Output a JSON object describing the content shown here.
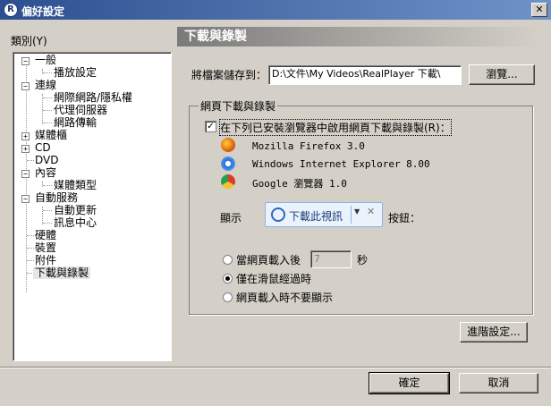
{
  "window": {
    "title": "偏好設定",
    "close_glyph": "✕",
    "app_icon_glyph": "R"
  },
  "category_label": "類別(Y)",
  "tree": {
    "items": [
      {
        "label": "一般",
        "toggle": "−"
      },
      {
        "label": "播放設定"
      },
      {
        "label": "連線",
        "toggle": "−"
      },
      {
        "label": "網際網路/隱私權"
      },
      {
        "label": "代理伺服器"
      },
      {
        "label": "網路傳輸"
      },
      {
        "label": "媒體櫃",
        "toggle": "+"
      },
      {
        "label": "CD",
        "toggle": "+"
      },
      {
        "label": "DVD"
      },
      {
        "label": "內容",
        "toggle": "−"
      },
      {
        "label": "媒體類型"
      },
      {
        "label": "自動服務",
        "toggle": "−"
      },
      {
        "label": "自動更新"
      },
      {
        "label": "訊息中心"
      },
      {
        "label": "硬體"
      },
      {
        "label": "裝置"
      },
      {
        "label": "附件"
      },
      {
        "label": "下載與錄製",
        "selected": true
      }
    ]
  },
  "panel": {
    "title": "下載與錄製",
    "save_label": "將檔案儲存到：",
    "save_path": "D:\\文件\\My Videos\\RealPlayer 下載\\",
    "browse_label": "瀏覽...",
    "group_title": "網頁下載與錄製",
    "enable_checkbox_label": "在下列已安裝瀏覽器中啟用網頁下載與錄製(R)：",
    "enable_checked": true,
    "check_glyph": "✓",
    "browsers": [
      {
        "name": "Mozilla Firefox 3.0",
        "icon": "firefox-icon",
        "color": "#e66000"
      },
      {
        "name": "Windows Internet Explorer 8.00",
        "icon": "ie-icon",
        "color": "#1e6fd9"
      },
      {
        "name": "Google 瀏覽器 1.0",
        "icon": "chrome-icon",
        "color": "#dd3b2a"
      }
    ],
    "show_label": "顯示",
    "button_suffix": "按鈕：",
    "download_button_text": "下載此視訊",
    "download_arrow_glyph": "▼",
    "download_close_glyph": "✕",
    "option_after_load_label": "當網頁載入後",
    "option_after_load_value": "7",
    "seconds_unit": "秒",
    "option_hover_label": "僅在滑鼠經過時",
    "option_never_label": "網頁載入時不要顯示",
    "selected_option": "hover",
    "advanced_label": "進階設定..."
  },
  "footer": {
    "ok_label": "確定",
    "cancel_label": "取消"
  }
}
